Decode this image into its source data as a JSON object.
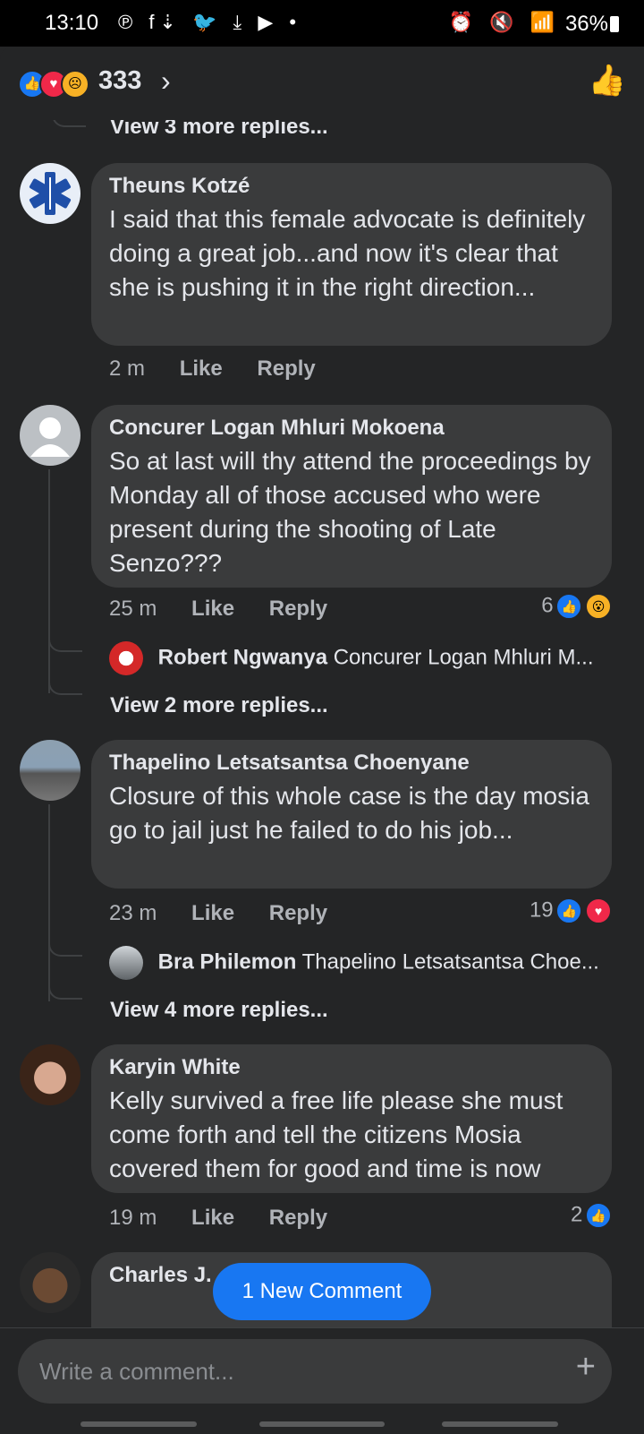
{
  "status_bar": {
    "time": "13:10",
    "left_icons": "℗ f⇣ 🐦 ⤓ ▶ •",
    "right_icons": "⏰ 🔇 📶",
    "battery": "36%"
  },
  "header": {
    "reaction_total": "333",
    "chevron": "›",
    "like_icon": "👍"
  },
  "top_view_replies": "View 3 more replies...",
  "comments": [
    {
      "author": "Theuns Kotzé",
      "text": "I said that this female advocate is definitely doing a great job...and now it's clear that she is pushing it in the right direction...",
      "time": "2 m",
      "like": "Like",
      "reply": "Reply"
    },
    {
      "author": "Concurer Logan Mhluri Mokoena",
      "text": "So at last will thy attend the proceedings by Monday all of those accused who were present during the shooting of Late Senzo???",
      "time": "25 m",
      "like": "Like",
      "reply": "Reply",
      "reaction_count": "6",
      "reply_preview": {
        "name": "Robert Ngwanya",
        "text": "Concurer Logan Mhluri M..."
      },
      "view_more": "View 2 more replies..."
    },
    {
      "author": "Thapelino Letsatsantsa Choenyane",
      "text": "Closure of this whole case is the day mosia go to jail just he failed to do his job...",
      "time": "23 m",
      "like": "Like",
      "reply": "Reply",
      "reaction_count": "19",
      "reply_preview": {
        "name": "Bra Philemon",
        "text": "Thapelino Letsatsantsa Choe..."
      },
      "view_more": "View 4 more replies..."
    },
    {
      "author": "Karyin White",
      "text": "Kelly survived a free life please she must come forth and tell the citizens Mosia covered them for good and time is now",
      "time": "19 m",
      "like": "Like",
      "reply": "Reply",
      "reaction_count": "2"
    },
    {
      "author": "Charles J."
    }
  ],
  "new_comment_pill": "1 New Comment",
  "composer": {
    "placeholder": "Write a comment...",
    "plus": "+"
  },
  "colors": {
    "background": "#242526",
    "bubble": "#3a3b3c",
    "accent": "#1877f2",
    "love": "#f02849"
  }
}
